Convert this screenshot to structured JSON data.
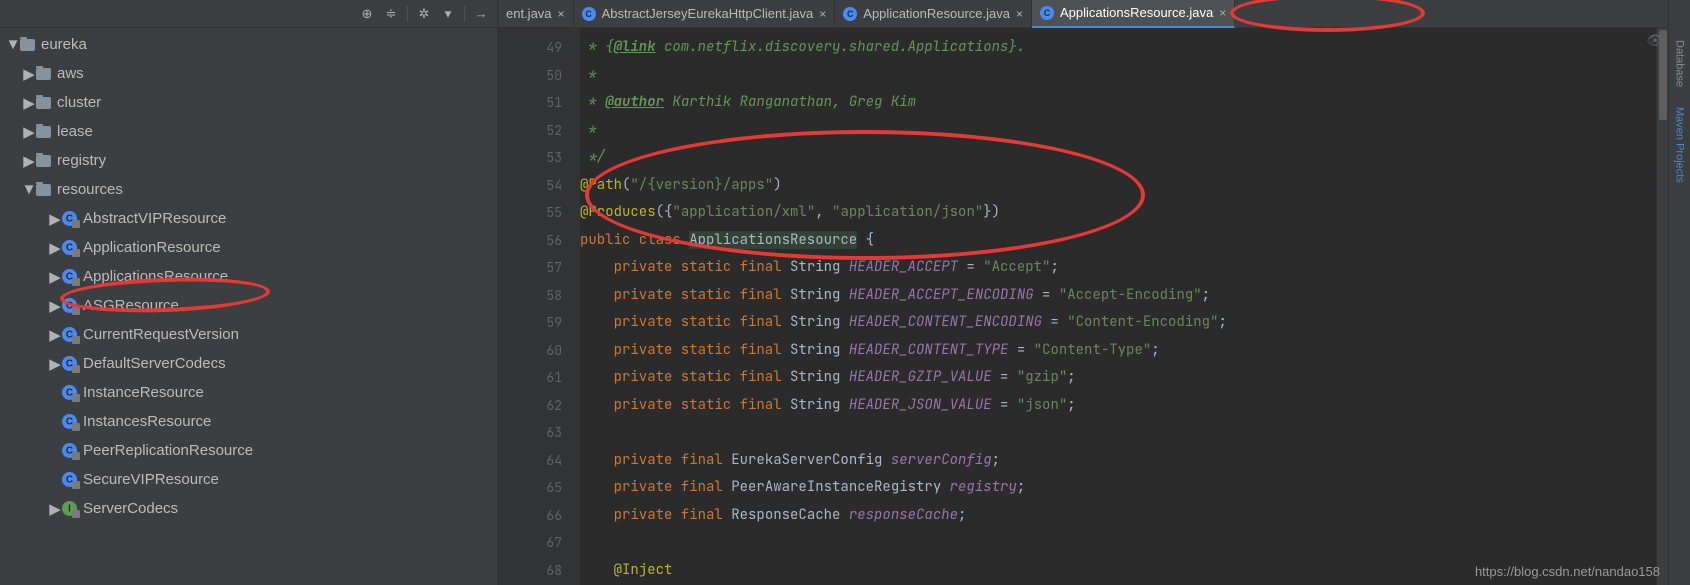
{
  "toolbar": {},
  "tree": {
    "root": "eureka",
    "folders": [
      {
        "label": "aws"
      },
      {
        "label": "cluster"
      },
      {
        "label": "lease"
      },
      {
        "label": "registry"
      },
      {
        "label": "resources",
        "expanded": true
      }
    ],
    "resources": [
      {
        "label": "AbstractVIPResource",
        "type": "class",
        "expandable": true
      },
      {
        "label": "ApplicationResource",
        "type": "class",
        "expandable": true
      },
      {
        "label": "ApplicationsResource",
        "type": "class",
        "expandable": true,
        "highlighted": true
      },
      {
        "label": "ASGResource",
        "type": "class",
        "expandable": true
      },
      {
        "label": "CurrentRequestVersion",
        "type": "class",
        "expandable": true
      },
      {
        "label": "DefaultServerCodecs",
        "type": "class",
        "expandable": true
      },
      {
        "label": "InstanceResource",
        "type": "class",
        "expandable": false
      },
      {
        "label": "InstancesResource",
        "type": "class",
        "expandable": false
      },
      {
        "label": "PeerReplicationResource",
        "type": "class",
        "expandable": false
      },
      {
        "label": "SecureVIPResource",
        "type": "class",
        "expandable": false
      },
      {
        "label": "ServerCodecs",
        "type": "interface",
        "expandable": true
      }
    ]
  },
  "tabs": [
    {
      "label": "ent.java",
      "partial": true
    },
    {
      "label": "AbstractJerseyEurekaHttpClient.java"
    },
    {
      "label": "ApplicationResource.java"
    },
    {
      "label": "ApplicationsResource.java",
      "active": true
    }
  ],
  "gutter": [
    "49",
    "50",
    "51",
    "52",
    "53",
    "54",
    "55",
    "56",
    "57",
    "58",
    "59",
    "60",
    "61",
    "62",
    "63",
    "64",
    "65",
    "66",
    "67",
    "68"
  ],
  "code": {
    "l49a": " * {",
    "l49link": "@link",
    "l49b": " com.netflix.discovery.shared.Applications}.",
    "l50": " *",
    "l51a": " * ",
    "l51tag": "@author",
    "l51b": " Karthik Ranganathan, Greg Kim",
    "l52": " *",
    "l53": " */",
    "l54anno": "@Path",
    "l54p": "(",
    "l54str": "\"/{version}/apps\"",
    "l54cp": ")",
    "l55anno": "@Produces",
    "l55p": "({",
    "l55s1": "\"application/xml\"",
    "l55c": ", ",
    "l55s2": "\"application/json\"",
    "l55cp": "})",
    "l56kw": "public class ",
    "l56cls": "ApplicationsResource",
    "l56b": " {",
    "l57kw": "private static final ",
    "l57t": "String ",
    "l57f": "HEADER_ACCEPT",
    "l57eq": " = ",
    "l57s": "\"Accept\"",
    "l57sc": ";",
    "l58kw": "private static final ",
    "l58t": "String ",
    "l58f": "HEADER_ACCEPT_ENCODING",
    "l58eq": " = ",
    "l58s": "\"Accept-Encoding\"",
    "l58sc": ";",
    "l59kw": "private static final ",
    "l59t": "String ",
    "l59f": "HEADER_CONTENT_ENCODING",
    "l59eq": " = ",
    "l59s": "\"Content-Encoding\"",
    "l59sc": ";",
    "l60kw": "private static final ",
    "l60t": "String ",
    "l60f": "HEADER_CONTENT_TYPE",
    "l60eq": " = ",
    "l60s": "\"Content-Type\"",
    "l60sc": ";",
    "l61kw": "private static final ",
    "l61t": "String ",
    "l61f": "HEADER_GZIP_VALUE",
    "l61eq": " = ",
    "l61s": "\"gzip\"",
    "l61sc": ";",
    "l62kw": "private static final ",
    "l62t": "String ",
    "l62f": "HEADER_JSON_VALUE",
    "l62eq": " = ",
    "l62s": "\"json\"",
    "l62sc": ";",
    "l64kw": "private final ",
    "l64t": "EurekaServerConfig ",
    "l64f": "serverConfig",
    "l64sc": ";",
    "l65kw": "private final ",
    "l65t": "PeerAwareInstanceRegistry ",
    "l65f": "registry",
    "l65sc": ";",
    "l66kw": "private final ",
    "l66t": "ResponseCache ",
    "l66f": "responseCache",
    "l66sc": ";",
    "l68anno": "@Inject"
  },
  "rightbar": {
    "label1": "Database",
    "label2": "Maven Projects"
  },
  "watermark": "https://blog.csdn.net/nandao158"
}
